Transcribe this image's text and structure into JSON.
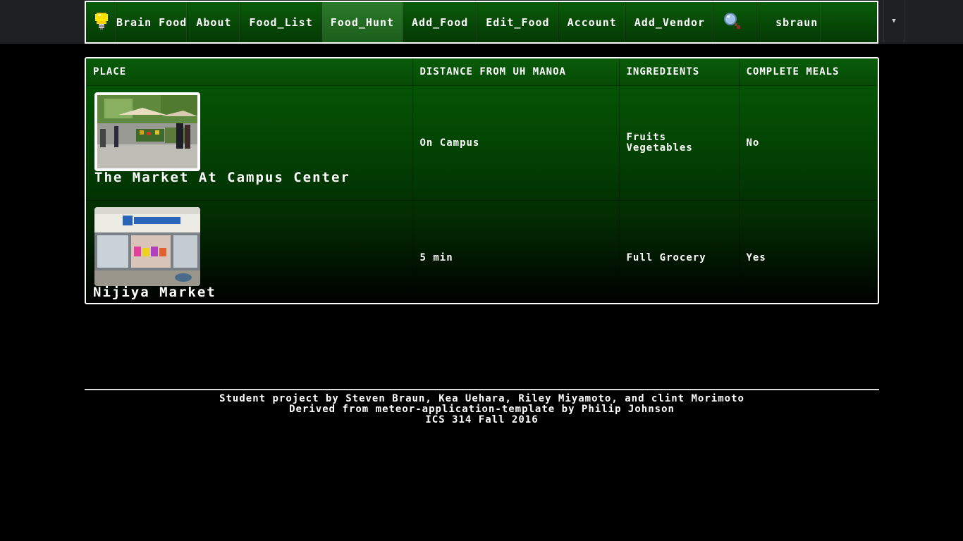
{
  "nav": {
    "brand": "Brain Food",
    "brand_icon": "lightbulb-icon",
    "items": [
      {
        "label": "About"
      },
      {
        "label": "Food_List"
      },
      {
        "label": "Food_Hunt",
        "active": true
      },
      {
        "label": "Add_Food"
      },
      {
        "label": "Edit_Food"
      },
      {
        "label": "Account"
      },
      {
        "label": "Add_Vendor"
      }
    ],
    "search_icon": "magnifier-icon",
    "user": "sbraun",
    "dropdown_icon": "caret-down-icon"
  },
  "table": {
    "headers": [
      "PLACE",
      "DISTANCE FROM UH MANOA",
      "INGREDIENTS",
      "COMPLETE MEALS"
    ],
    "rows": [
      {
        "place": "The Market At Campus Center",
        "distance": "On Campus",
        "ingredients_line1": "Fruits",
        "ingredients_line2": "Vegetables",
        "complete_meals": "No"
      },
      {
        "place": "Nijiya Market",
        "distance": "5 min",
        "ingredients_line1": "Full Grocery",
        "complete_meals": "Yes"
      }
    ]
  },
  "footer": {
    "line1": "Student project by Steven Braun, Kea Uehara, Riley Miyamoto, and clint Morimoto",
    "line2": "Derived from meteor-application-template by Philip Johnson",
    "line3": "ICS 314 Fall 2016"
  },
  "colors": {
    "nav_green": "#0a5c0a",
    "active_green": "#2a7a2a",
    "page_bg": "#000000",
    "topbar_bg": "#1f2022"
  }
}
